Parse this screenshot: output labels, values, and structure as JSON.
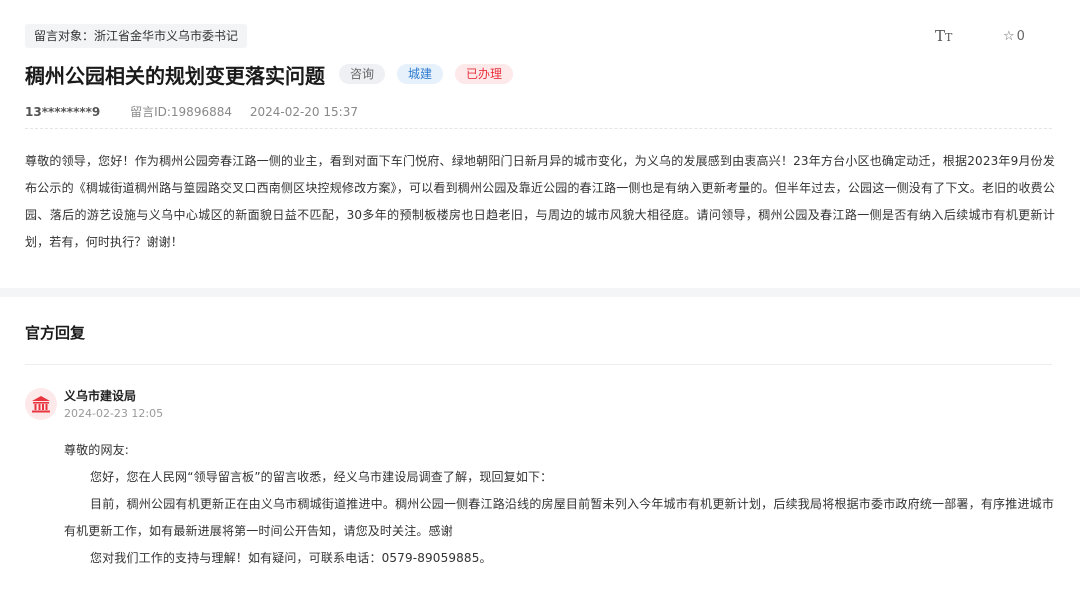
{
  "recipient": "留言对象：浙江省金华市义乌市委书记",
  "toolbar": {
    "font_icon_main": "T",
    "font_icon_small": "T",
    "star_icon": "☆",
    "favorite_count": "0"
  },
  "post": {
    "title": "稠州公园相关的规划变更落实问题",
    "tags": [
      "咨询",
      "城建",
      "已办理"
    ],
    "user": "13********9",
    "message_id": "留言ID:19896884",
    "datetime": "2024-02-20 15:37",
    "content": "尊敬的领导，您好！作为稠州公园旁春江路一侧的业主，看到对面下车门悦府、绿地朝阳门日新月异的城市变化，为义乌的发展感到由衷高兴！23年方台小区也确定动迁，根据2023年9月份发布公示的《稠城街道稠州路与篁园路交叉口西南侧区块控规修改方案》，可以看到稠州公园及靠近公园的春江路一侧也是有纳入更新考量的。但半年过去，公园这一侧没有了下文。老旧的收费公园、落后的游艺设施与义乌中心城区的新面貌日益不匹配，30多年的预制板楼房也日趋老旧，与周边的城市风貌大相径庭。请问领导，稠州公园及春江路一侧是否有纳入后续城市有机更新计划，若有，何时执行？谢谢！"
  },
  "reply": {
    "section_title": "官方回复",
    "org": "义乌市建设局",
    "date": "2024-02-23 12:05",
    "greeting": "尊敬的网友:",
    "paragraphs": [
      "您好，您在人民网“领导留言板”的留言收悉，经义乌市建设局调查了解，现回复如下：",
      "目前，稠州公园有机更新正在由义乌市稠城街道推进中。稠州公园一侧春江路沿线的房屋目前暂未列入今年城市有机更新计划，后续我局将根据市委市政府统一部署，有序推进城市有机更新工作，如有最新进展将第一时间公开告知，请您及时关注。感谢",
      "您对我们工作的支持与理解！如有疑问，可联系电话：0579-89059885。"
    ]
  },
  "colors": {
    "tag_blue": "#2f7bd1",
    "tag_red": "#e8353f",
    "avatar_bg": "#fde9ea",
    "avatar_icon": "#e8353f"
  },
  "icons": {
    "font_size": "font-size-icon",
    "favorite": "star-icon",
    "org": "government-building-icon"
  }
}
